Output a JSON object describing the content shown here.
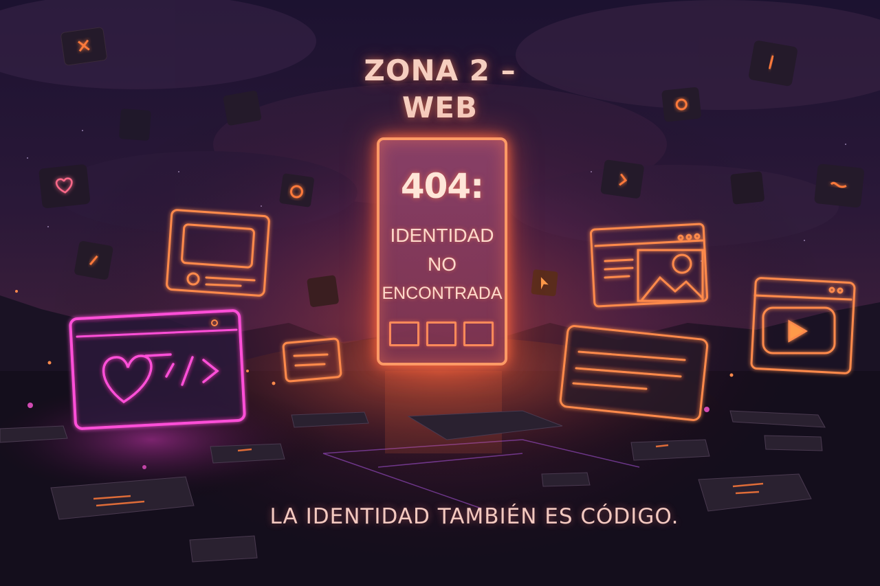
{
  "scene": {
    "title_lines": [
      "ZONA 2 –",
      "WEB"
    ],
    "sign": {
      "code": "404:",
      "message_lines": [
        "IDENTIDAD",
        "NO",
        "ENCONTRADA"
      ]
    },
    "tagline": "LA IDENTIDAD TAMBIÉN ES CÓDIGO."
  },
  "icons": [
    "heart-icon",
    "code-icon",
    "image-icon",
    "play-icon",
    "close-icon",
    "cursor-icon"
  ],
  "colors": {
    "neon_orange": "#ff8a4c",
    "neon_pink": "#ff4fd8",
    "sky_dark": "#140b22",
    "text_glow": "#f6cfc0"
  }
}
